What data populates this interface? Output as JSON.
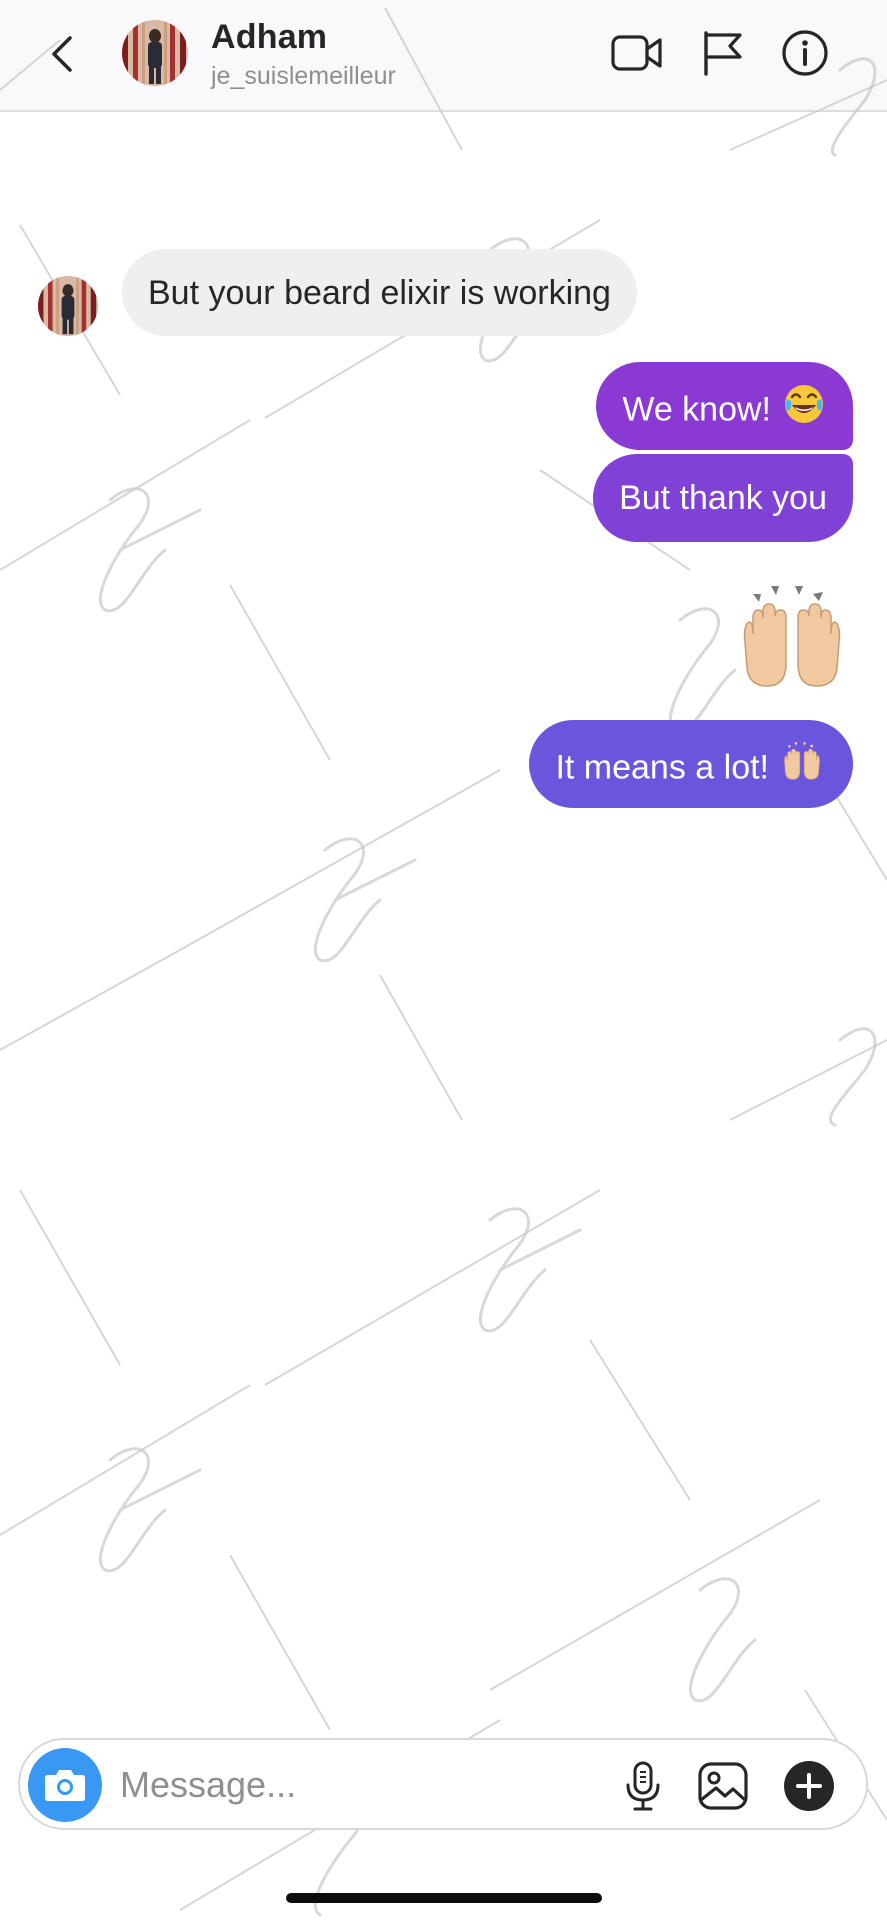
{
  "header": {
    "contact_name": "Adham",
    "contact_handle": "je_suislemeilleur",
    "icons": [
      "back-chevron-icon",
      "video-call-icon",
      "flag-icon",
      "info-icon"
    ]
  },
  "messages": [
    {
      "direction": "incoming",
      "text": "But your beard elixir is working"
    },
    {
      "direction": "outgoing",
      "text": "We know!",
      "emoji": "😂"
    },
    {
      "direction": "outgoing",
      "text": "But thank you"
    },
    {
      "direction": "outgoing",
      "emoji_only": "🙌"
    },
    {
      "direction": "outgoing",
      "text": "It means a lot!",
      "emoji": "🙌"
    }
  ],
  "composer": {
    "placeholder": "Message...",
    "icons": [
      "camera-icon",
      "microphone-icon",
      "gallery-icon",
      "plus-icon"
    ]
  },
  "colors": {
    "incoming_bubble": "#efefef",
    "outgoing_bubble_1": "#8a3ad3",
    "outgoing_bubble_2": "#7f41d6",
    "outgoing_bubble_3": "#6a56dc",
    "camera_button": "#3898f3"
  }
}
